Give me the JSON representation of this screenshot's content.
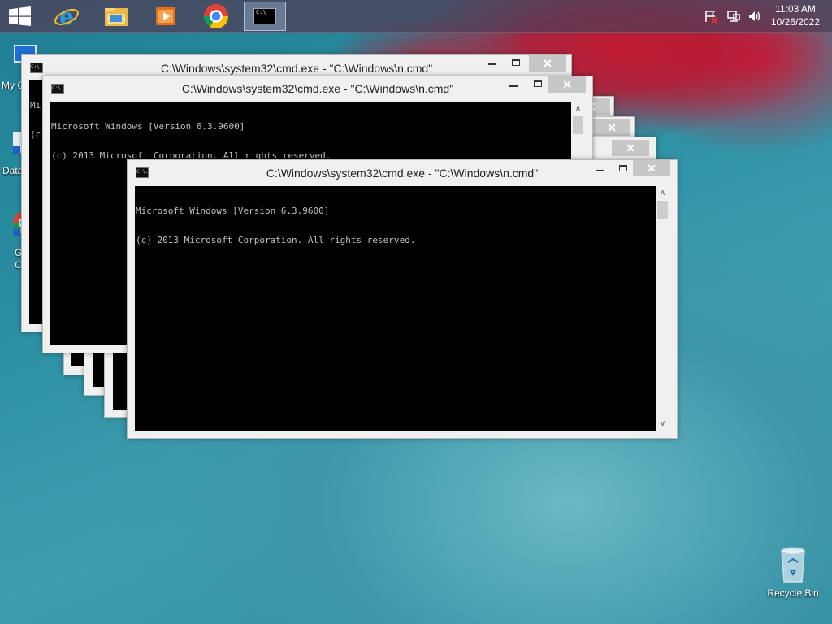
{
  "taskbar": {
    "apps": [
      {
        "name": "Internet Explorer"
      },
      {
        "name": "File Explorer"
      },
      {
        "name": "Windows Media Player"
      },
      {
        "name": "Google Chrome"
      },
      {
        "name": "Command Prompt",
        "icon_text": "C:\\_"
      }
    ],
    "clock": {
      "time": "11:03 AM",
      "date": "10/26/2022"
    }
  },
  "desktop_icons": [
    {
      "label": "My C"
    },
    {
      "label": "Data"
    },
    {
      "label": "G\nC"
    },
    {
      "label": "Recycle Bin"
    }
  ],
  "cmd_window": {
    "title": "C:\\Windows\\system32\\cmd.exe - \"C:\\Windows\\n.cmd\"",
    "icon_text": "C:\\.",
    "close_symbol": "✕",
    "console_line1": "Microsoft Windows [Version 6.3.9600]",
    "console_line2": "(c) 2013 Microsoft Corporation. All rights reserved.",
    "back_console_fragment1": "Mi",
    "back_console_fragment2": "(c",
    "scroll_up": "∧",
    "scroll_down": "∨"
  },
  "colors": {
    "taskbar": "#4e3c55",
    "console_bg": "#000000",
    "console_text": "#c0c0c0",
    "window_frame": "#f0f0f0",
    "close_inactive": "#c7c7c7"
  }
}
